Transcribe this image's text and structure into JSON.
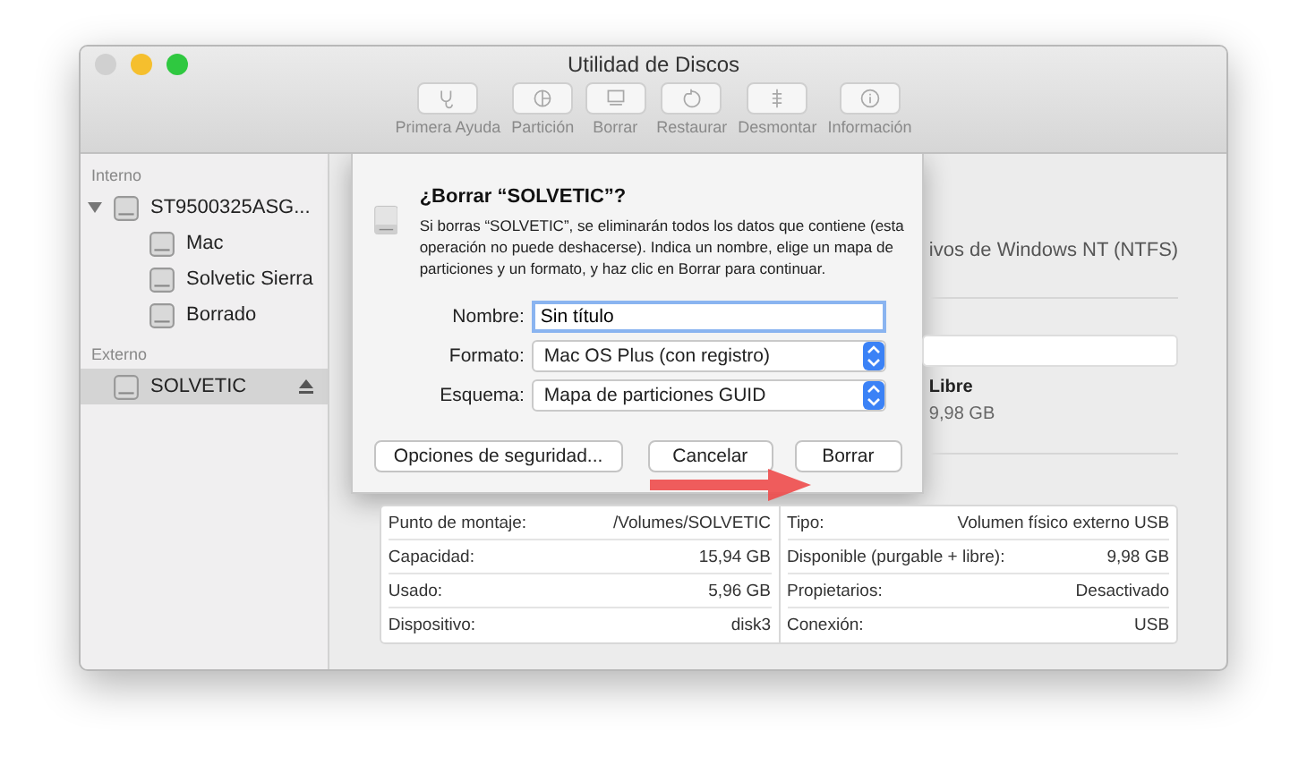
{
  "window": {
    "title": "Utilidad de Discos",
    "controls": [
      {
        "color": "#d0d0d0"
      },
      {
        "color": "#f5bf2e"
      },
      {
        "color": "#2fc840"
      }
    ]
  },
  "toolbar": [
    {
      "label": "Primera Ayuda",
      "disabled": true
    },
    {
      "label": "Partición",
      "disabled": true
    },
    {
      "label": "Borrar",
      "disabled": true
    },
    {
      "label": "Restaurar",
      "disabled": true
    },
    {
      "label": "Desmontar",
      "disabled": true
    },
    {
      "label": "Información",
      "disabled": true
    }
  ],
  "sidebar": {
    "sections": [
      {
        "label": "Interno",
        "items": [
          {
            "label": "ST9500325ASG...",
            "selected": false,
            "expanded": true,
            "eject": false,
            "children": [
              {
                "label": "Mac",
                "selected": false,
                "eject": false
              },
              {
                "label": "Solvetic Sierra",
                "selected": false,
                "eject": false
              },
              {
                "label": "Borrado",
                "selected": false,
                "eject": false
              }
            ]
          }
        ]
      },
      {
        "label": "Externo",
        "items": [
          {
            "label": "SOLVETIC",
            "selected": true,
            "eject": true
          }
        ]
      }
    ]
  },
  "dialog": {
    "title": "¿Borrar “SOLVETIC”?",
    "message": "Si borras “SOLVETIC”, se eliminarán todos los datos que contiene (esta operación no puede deshacerse). Indica un nombre, elige un mapa de particiones y un formato, y haz clic en Borrar para continuar.",
    "fields": [
      {
        "kind": "text",
        "label": "Nombre:",
        "value": "Sin título"
      },
      {
        "kind": "select",
        "label": "Formato:",
        "value": "Mac OS Plus (con registro)"
      },
      {
        "kind": "select",
        "label": "Esquema:",
        "value": "Mapa de particiones GUID"
      }
    ],
    "buttons": [
      {
        "label": "Opciones de seguridad...",
        "kind": "secondary"
      },
      {
        "label": "Cancelar",
        "kind": "cancel"
      },
      {
        "label": "Borrar",
        "kind": "default"
      }
    ]
  },
  "volume": {
    "description": "ivos de Windows NT (NTFS)",
    "free_label": "Libre",
    "free_value": "9,98 GB"
  },
  "info": {
    "left": [
      {
        "label": "Punto de montaje:",
        "value": "/Volumes/SOLVETIC"
      },
      {
        "label": "Capacidad:",
        "value": "15,94 GB"
      },
      {
        "label": "Usado:",
        "value": "5,96 GB"
      },
      {
        "label": "Dispositivo:",
        "value": "disk3"
      }
    ],
    "right": [
      {
        "label": "Tipo:",
        "value": "Volumen físico externo USB"
      },
      {
        "label": "Disponible (purgable + libre):",
        "value": "9,98 GB"
      },
      {
        "label": "Propietarios:",
        "value": "Desactivado"
      },
      {
        "label": "Conexión:",
        "value": "USB"
      }
    ]
  },
  "annotation": {
    "kind": "arrow"
  }
}
